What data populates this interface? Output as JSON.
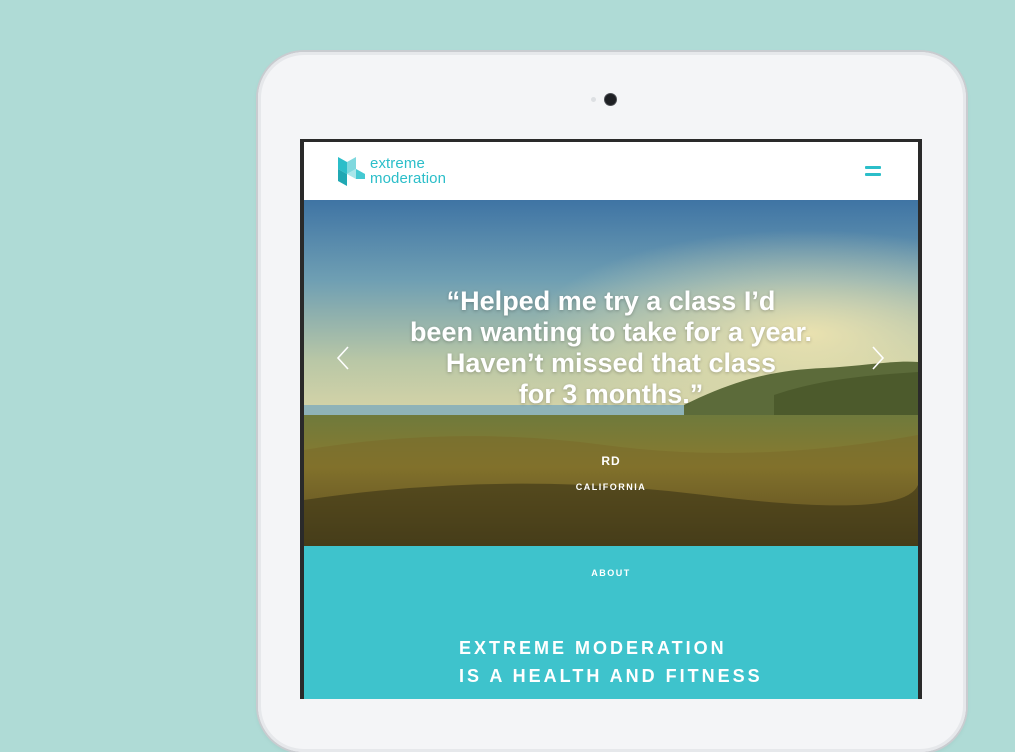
{
  "brand": {
    "line1": "extreme",
    "line2": "moderation",
    "color": "#2bbec9"
  },
  "header": {
    "menu_icon": "hamburger-menu-icon"
  },
  "testimonial": {
    "quote_lines": [
      "“Helped me try a class I’d",
      "been wanting to take for a year.",
      "Haven’t missed that class",
      "for 3 months.”"
    ],
    "author": "RD",
    "location": "CALIFORNIA",
    "prev_icon": "chevron-left-icon",
    "next_icon": "chevron-right-icon"
  },
  "about": {
    "label": "ABOUT",
    "heading_lines": [
      "EXTREME MODERATION",
      "IS A HEALTH AND FITNESS"
    ],
    "background": "#3ec3cc"
  },
  "page": {
    "background": "#afdbd6"
  }
}
